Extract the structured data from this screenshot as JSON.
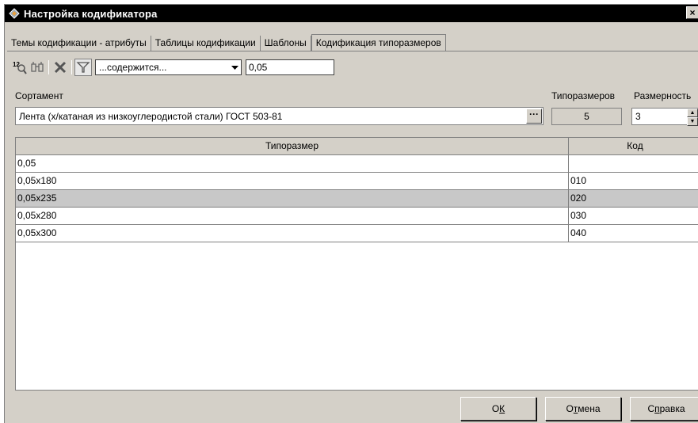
{
  "window": {
    "title": "Настройка кодификатора",
    "close_label": "×"
  },
  "tabs": [
    {
      "label": "Темы кодификации - атрибуты",
      "active": false
    },
    {
      "label": "Таблицы кодификации",
      "active": false
    },
    {
      "label": "Шаблоны",
      "active": false
    },
    {
      "label": "Кодификация типоразмеров",
      "active": true
    }
  ],
  "toolbar": {
    "icons": [
      "numbering-icon",
      "binoculars-icon",
      "delete-icon",
      "filter-icon"
    ],
    "condition_value": "...содержится...",
    "filter_value": "0,05"
  },
  "assortment": {
    "label": "Сортамент",
    "value": "Лента (х/катаная из низкоуглеродистой стали) ГОСТ 503-81",
    "browse_label": "···"
  },
  "sizes_count": {
    "label": "Типоразмеров",
    "value": "5"
  },
  "dimension": {
    "label": "Размерность",
    "value": "3"
  },
  "grid": {
    "columns": [
      "Типоразмер",
      "Код"
    ],
    "rows": [
      {
        "size": "0,05",
        "code": "",
        "selected": false
      },
      {
        "size": "0,05х180",
        "code": "010",
        "selected": false
      },
      {
        "size": "0,05х235",
        "code": "020",
        "selected": true
      },
      {
        "size": "0,05х280",
        "code": "030",
        "selected": false
      },
      {
        "size": "0,05х300",
        "code": "040",
        "selected": false
      }
    ]
  },
  "buttons": {
    "ok": {
      "pre": "О",
      "mnemonic": "К",
      "post": ""
    },
    "cancel": {
      "pre": "О",
      "mnemonic": "т",
      "post": "мена"
    },
    "help": {
      "pre": "С",
      "mnemonic": "п",
      "post": "равка"
    }
  },
  "colors": {
    "titlebar": "#000000",
    "face": "#d4d0c8",
    "selected_row": "#c8c8c8"
  }
}
